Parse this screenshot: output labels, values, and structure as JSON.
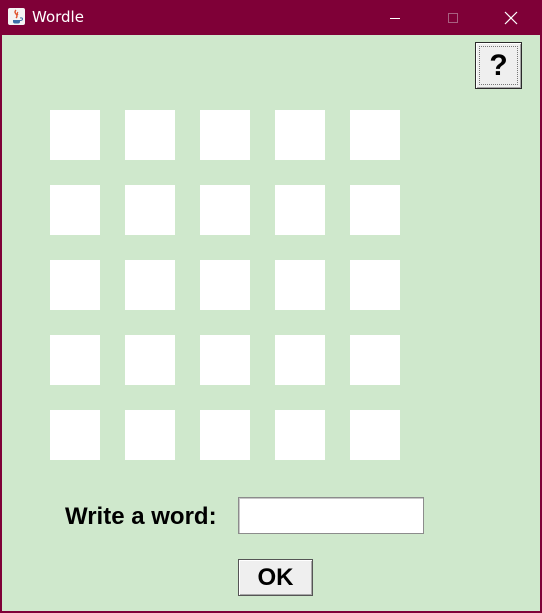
{
  "window": {
    "title": "Wordle",
    "icon": "java-icon",
    "controls": [
      "minimize-icon",
      "maximize-icon",
      "close-icon"
    ]
  },
  "help_button": {
    "label": "?"
  },
  "grid": {
    "rows": 5,
    "columns": 5,
    "tile_color": "#ffffff"
  },
  "prompt": {
    "label": "Write a word:",
    "value": ""
  },
  "ok_button": {
    "label": "OK"
  },
  "colors": {
    "title_bar": "#7f0037",
    "background": "#cfe8cc"
  }
}
